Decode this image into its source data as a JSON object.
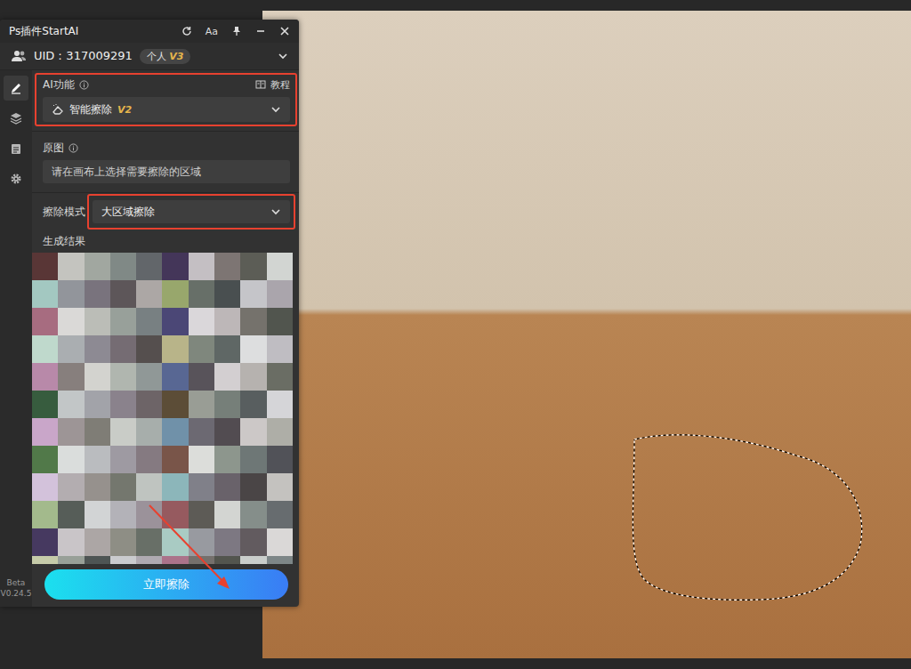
{
  "window": {
    "title": "Ps插件StartAI",
    "font_button": "Aa"
  },
  "account": {
    "uid": "UID：317009291",
    "plan": "个人",
    "plan_level": "V3"
  },
  "rail": {
    "items": [
      {
        "kind": "edit",
        "selected": true
      },
      {
        "kind": "layers",
        "selected": false
      },
      {
        "kind": "notes",
        "selected": false
      },
      {
        "kind": "settings",
        "selected": false
      }
    ]
  },
  "version": {
    "label": "Beta",
    "number": "V0.24.5"
  },
  "ai_function": {
    "label": "AI功能",
    "tutorial": "教程",
    "value": "智能擦除",
    "value_version": "V2"
  },
  "source": {
    "label": "原图",
    "placeholder": "请在画布上选择需要擦除的区域"
  },
  "erase_mode": {
    "label": "擦除模式",
    "value": "大区域擦除"
  },
  "result": {
    "label": "生成结果"
  },
  "action": {
    "label": "立即擦除"
  }
}
